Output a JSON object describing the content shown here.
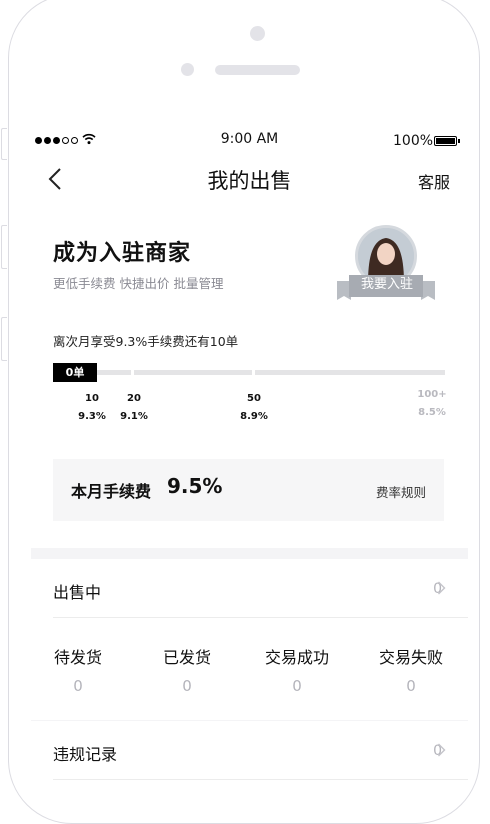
{
  "status_bar": {
    "time": "9:00 AM",
    "battery": "100%"
  },
  "nav": {
    "title": "我的出售",
    "right_action": "客服"
  },
  "merchant": {
    "title": "成为入驻商家",
    "subtitle": "更低手续费  快捷出价  批量管理",
    "join_label": "我要入驻"
  },
  "progress": {
    "note": "离次月享受9.3%手续费还有10单",
    "current_badge": "0单",
    "tiers": [
      {
        "count": "10",
        "rate": "9.3%"
      },
      {
        "count": "20",
        "rate": "9.1%"
      },
      {
        "count": "50",
        "rate": "8.9%"
      },
      {
        "count": "100+",
        "rate": "8.5%"
      }
    ]
  },
  "fee": {
    "label": "本月手续费",
    "value": "9.5%",
    "rules_link": "费率规则"
  },
  "selling": {
    "label": "出售中",
    "count": "0"
  },
  "stats": [
    {
      "label": "待发货",
      "value": "0"
    },
    {
      "label": "已发货",
      "value": "0"
    },
    {
      "label": "交易成功",
      "value": "0"
    },
    {
      "label": "交易失败",
      "value": "0"
    }
  ],
  "violations": {
    "label": "违规记录",
    "count": "0"
  },
  "colors": {
    "accent": "#000000",
    "muted": "#8a8a93",
    "page_bg": "#f4f4f6"
  }
}
